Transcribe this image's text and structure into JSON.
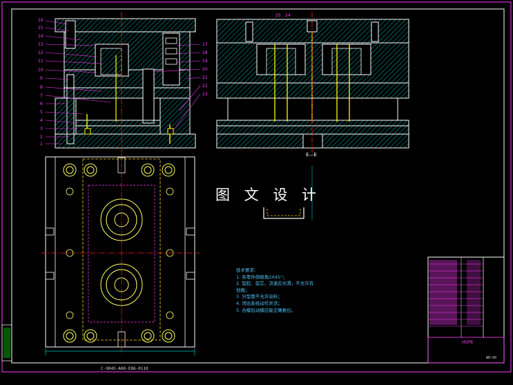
{
  "watermark": "图 文 设 计",
  "section_label": "E—E",
  "drawing_number": "C-9045-A08-E86-0110",
  "tech_notes": {
    "title": "技术要求:",
    "lines": [
      "1. 各零件倒棱角2X45°；",
      "2. 型腔、型芯，浇道应光滑，不允许有",
      "   划痕；",
      "3. 分型面不允许溢料；",
      "4. 顶出系统动作灵活；",
      "5. 合模后动模应能正确复位。"
    ]
  },
  "title_block": {
    "name": "HOPE",
    "code": "WH-00"
  },
  "part_numbers_left": [
    "16",
    "15",
    "14",
    "13",
    "12",
    "11",
    "10",
    "9",
    "8",
    "7",
    "6",
    "5",
    "4",
    "3",
    "2",
    "1"
  ],
  "part_numbers_right": [
    "17",
    "18",
    "19",
    "20",
    "21",
    "22",
    "23"
  ],
  "top_center_labels": [
    "25",
    "24"
  ],
  "colors": {
    "frame": "#ffffff",
    "outline": "#ffffff",
    "hatch": "#00c8c8",
    "leader": "#ff3cff",
    "centerline": "#ff2020",
    "pin": "#ffff00",
    "circle": "#ffff66",
    "hidden": "#ffd400",
    "note_text": "#4fc3f7",
    "title_block": "#ff3cff"
  }
}
